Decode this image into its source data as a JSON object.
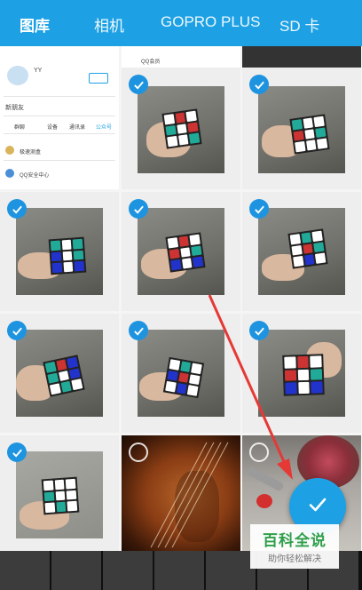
{
  "tabs": [
    {
      "label": "图库",
      "active": true
    },
    {
      "label": "相机",
      "active": false
    },
    {
      "label": "GOPRO PLUS",
      "active": false
    },
    {
      "label": "SD 卡",
      "active": false
    }
  ],
  "first_cell_text": {
    "contact_name": "YY",
    "new_friend": "新朋友",
    "tabs": [
      "群聊",
      "设备",
      "通讯录",
      "公众号"
    ],
    "row1": "极速测盒",
    "row2": "QQ安全中心",
    "top_label": "QQ会员"
  },
  "fab_icon": "check-icon",
  "watermark": {
    "title": "百科全说",
    "subtitle": "助你轻松解决"
  },
  "colors": {
    "accent": "#1da1e4",
    "check": "#1e94e0",
    "arrow": "#e53935",
    "watermark_green": "#2e9f4a"
  }
}
